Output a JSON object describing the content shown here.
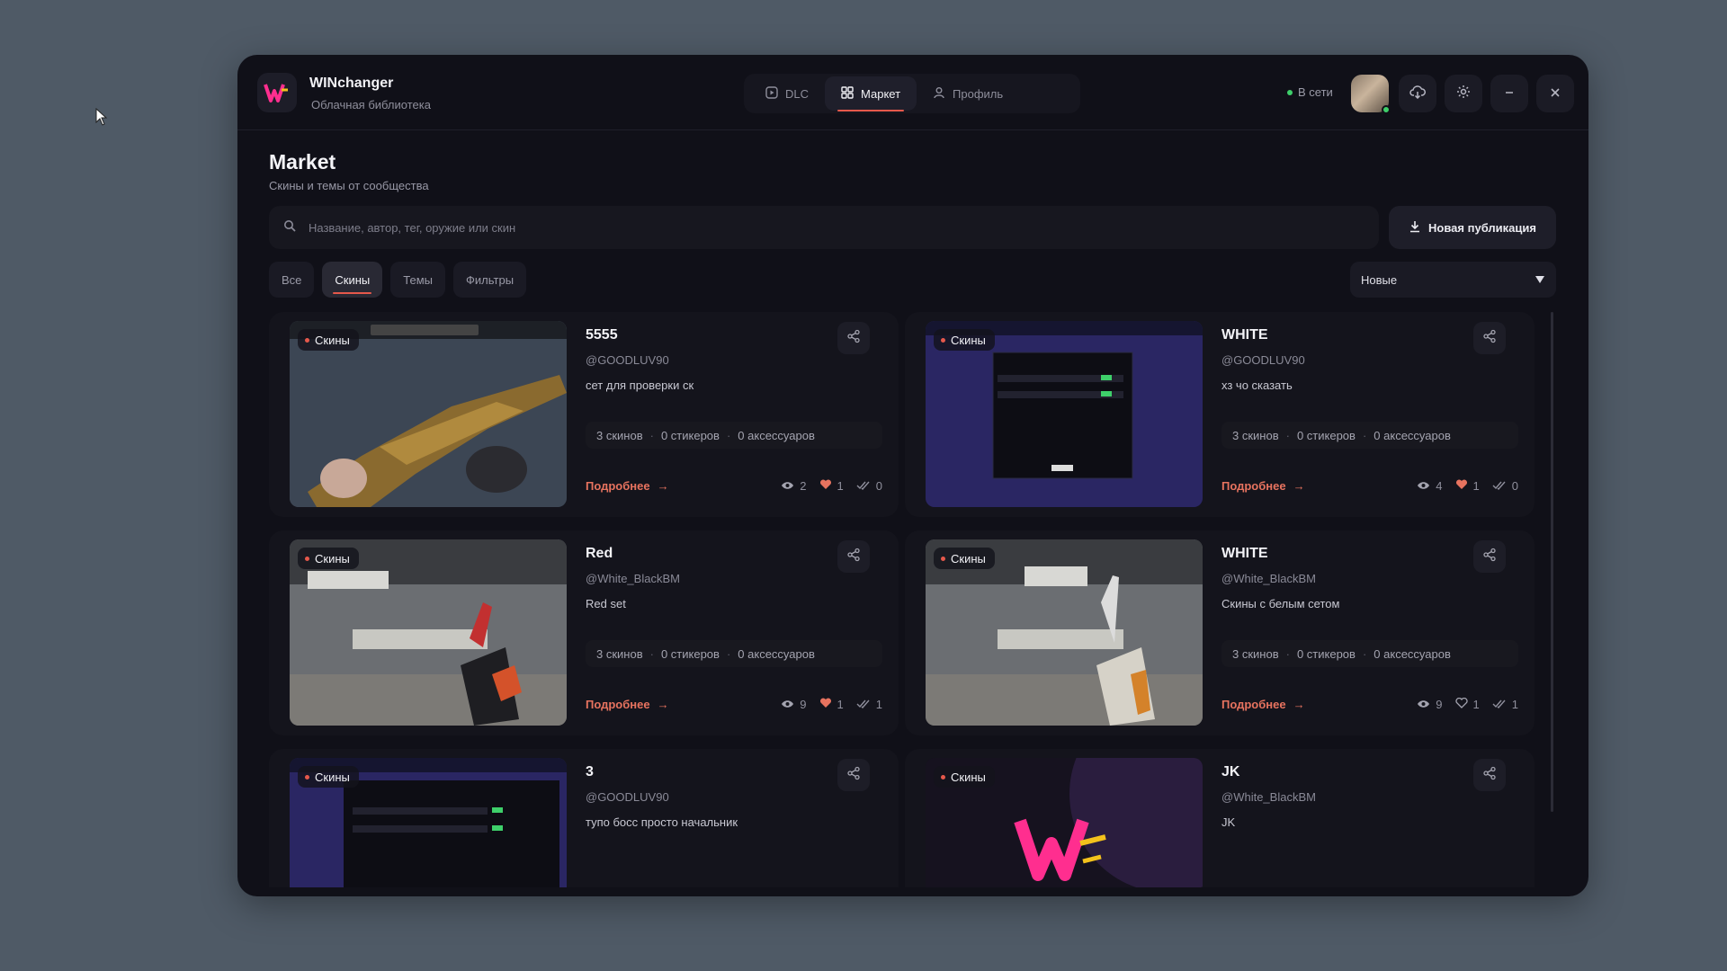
{
  "app": {
    "title": "WINchanger",
    "subtitle": "Облачная библиотека"
  },
  "nav": {
    "tabs": [
      {
        "label": "DLC"
      },
      {
        "label": "Маркет"
      },
      {
        "label": "Профиль"
      }
    ]
  },
  "status": {
    "label": "В сети"
  },
  "page": {
    "title": "Market",
    "subtitle": "Скины и темы от сообщества"
  },
  "search": {
    "placeholder": "Название, автор, тег, оружие или скин"
  },
  "new_publication": "Новая публикация",
  "filters": [
    "Все",
    "Скины",
    "Темы",
    "Фильтры"
  ],
  "sort": {
    "value": "Новые"
  },
  "cards": [
    {
      "tag": "Скины",
      "title": "5555",
      "author": "@GOODLUV90",
      "description": "сет для проверки ск",
      "skins": "3 скинов",
      "stickers": "0 стикеров",
      "accessories": "0 аксессуаров",
      "more": "Подробнее",
      "views": "2",
      "likes": "1",
      "installs": "0",
      "liked": true
    },
    {
      "tag": "Скины",
      "title": "WHITE",
      "author": "@GOODLUV90",
      "description": "хз чо сказать",
      "skins": "3 скинов",
      "stickers": "0 стикеров",
      "accessories": "0 аксессуаров",
      "more": "Подробнее",
      "views": "4",
      "likes": "1",
      "installs": "0",
      "liked": true
    },
    {
      "tag": "Скины",
      "title": "Red",
      "author": "@White_BlackBM",
      "description": "Red set",
      "skins": "3 скинов",
      "stickers": "0 стикеров",
      "accessories": "0 аксессуаров",
      "more": "Подробнее",
      "views": "9",
      "likes": "1",
      "installs": "1",
      "liked": true
    },
    {
      "tag": "Скины",
      "title": "WHITE",
      "author": "@White_BlackBM",
      "description": "Скины с белым сетом",
      "skins": "3 скинов",
      "stickers": "0 стикеров",
      "accessories": "0 аксессуаров",
      "more": "Подробнее",
      "views": "9",
      "likes": "1",
      "installs": "1",
      "liked": false
    },
    {
      "tag": "Скины",
      "title": "3",
      "author": "@GOODLUV90",
      "description": "тупо босс просто начальник"
    },
    {
      "tag": "Скины",
      "title": "JK",
      "author": "@White_BlackBM",
      "description": "JK"
    }
  ],
  "colors": {
    "accent": "#e5584b",
    "online": "#3ecf6a",
    "background": "#4f5a66",
    "window": "#101018"
  }
}
